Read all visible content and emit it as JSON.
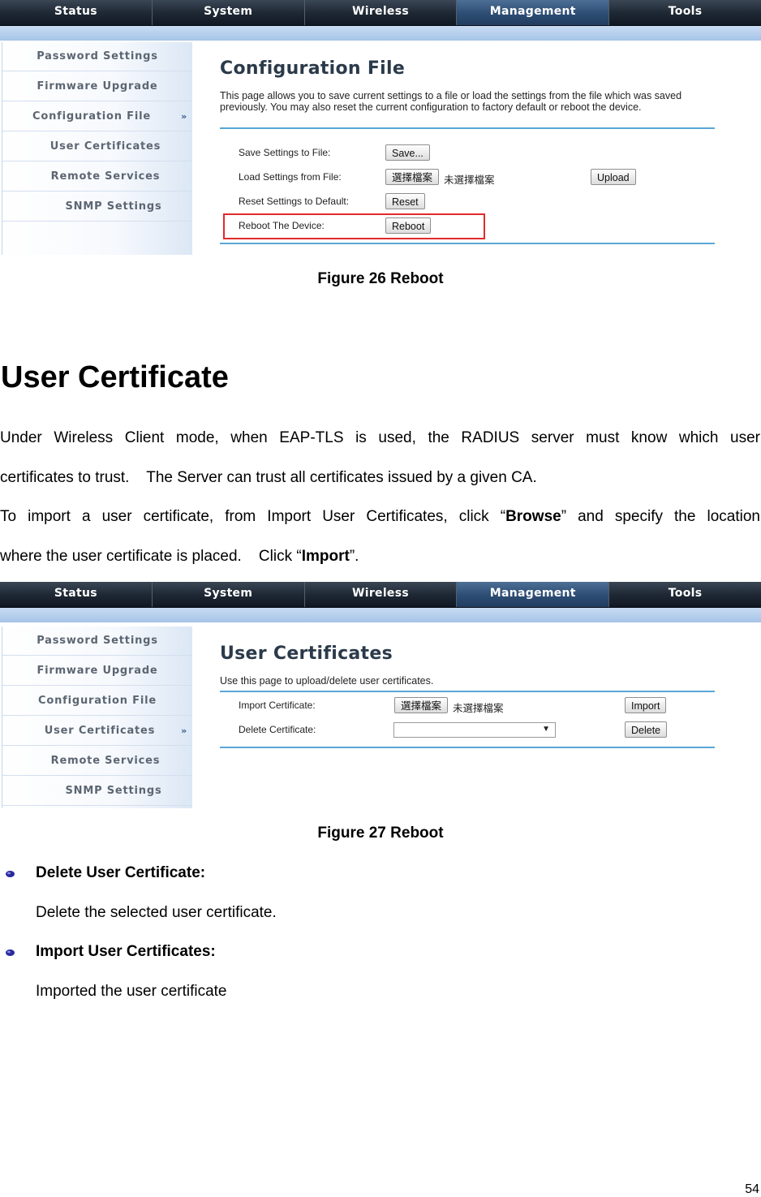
{
  "figure1": {
    "nav": [
      "Status",
      "System",
      "Wireless",
      "Management",
      "Tools"
    ],
    "active_nav": "Management",
    "sidebar": [
      "Password Settings",
      "Firmware Upgrade",
      "Configuration File",
      "User Certificates",
      "Remote Services",
      "SNMP Settings"
    ],
    "active_sidebar": "Configuration File",
    "title": "Configuration File",
    "description": "This page allows you to save current settings to a file or load the settings from the file which was saved previously. You may also reset the current configuration to factory default or reboot the device.",
    "rows": {
      "save_label": "Save Settings to File:",
      "save_button": "Save...",
      "load_label": "Load Settings from File:",
      "choose_button": "選擇檔案",
      "no_file": "未選擇檔案",
      "upload_button": "Upload",
      "reset_label": "Reset Settings to Default:",
      "reset_button": "Reset",
      "reboot_label": "Reboot The Device:",
      "reboot_button": "Reboot"
    },
    "caption": "Figure 26 Reboot"
  },
  "section": {
    "heading": "User Certificate",
    "p1_line1": "Under Wireless Client mode, when EAP-TLS is used, the RADIUS server must know which user",
    "p1_line2": "certificates to trust.    The Server can trust all certificates issued by a given CA.",
    "p2_line1_a": "To import a user certificate, from Import User Certificates, click “",
    "p2_line1_b": "Browse",
    "p2_line1_c": "” and specify the location",
    "p2_line2_a": "where the user certificate is placed.    Click “",
    "p2_line2_b": "Import",
    "p2_line2_c": "”."
  },
  "figure2": {
    "nav": [
      "Status",
      "System",
      "Wireless",
      "Management",
      "Tools"
    ],
    "active_nav": "Management",
    "sidebar": [
      "Password Settings",
      "Firmware Upgrade",
      "Configuration File",
      "User Certificates",
      "Remote Services",
      "SNMP Settings"
    ],
    "active_sidebar": "User Certificates",
    "title": "User Certificates",
    "description": "Use this page to upload/delete user certificates.",
    "rows": {
      "import_label": "Import Certificate:",
      "choose_button": "選擇檔案",
      "no_file": "未選擇檔案",
      "import_button": "Import",
      "delete_label": "Delete Certificate:",
      "delete_select_value": "",
      "delete_button": "Delete"
    },
    "caption": "Figure 27 Reboot"
  },
  "bullets": [
    {
      "title": "Delete User Certificate:",
      "text": "Delete the selected user certificate."
    },
    {
      "title": "Import User Certificates:",
      "text": "Imported the user certificate"
    }
  ],
  "page_number": "54",
  "colors": {
    "highlight": "#e12a2a",
    "rule": "#5aa7d6",
    "nav_active": "#2f4f76"
  }
}
